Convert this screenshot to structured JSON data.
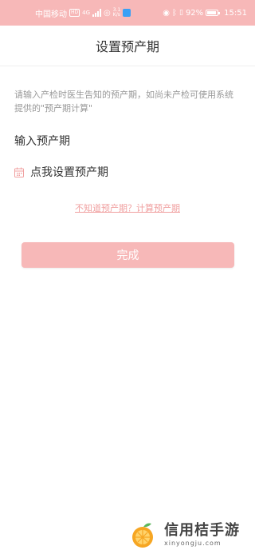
{
  "status_bar": {
    "carrier": "中国移动",
    "hd_badge": "HD",
    "network": "4G",
    "speed_top": "3.1",
    "speed_bottom": "K/s",
    "battery_percent": "92%",
    "time": "15:51"
  },
  "header": {
    "title": "设置预产期"
  },
  "main": {
    "intro_text": "请输入产检时医生告知的预产期，如尚未产检可使用系统 提供的\"预产期计算\"",
    "section_label": "输入预产期",
    "date_placeholder": "点我设置预产期",
    "calc_link": "不知道预产期？计算预产期",
    "done_button": "完成"
  },
  "watermark": {
    "name": "信用桔手游",
    "url": "xinyongju.com"
  },
  "colors": {
    "status_bar_bg": "#f7b8b8",
    "accent_pink": "#f0a0a0",
    "button_bg": "#f7b8b8"
  }
}
